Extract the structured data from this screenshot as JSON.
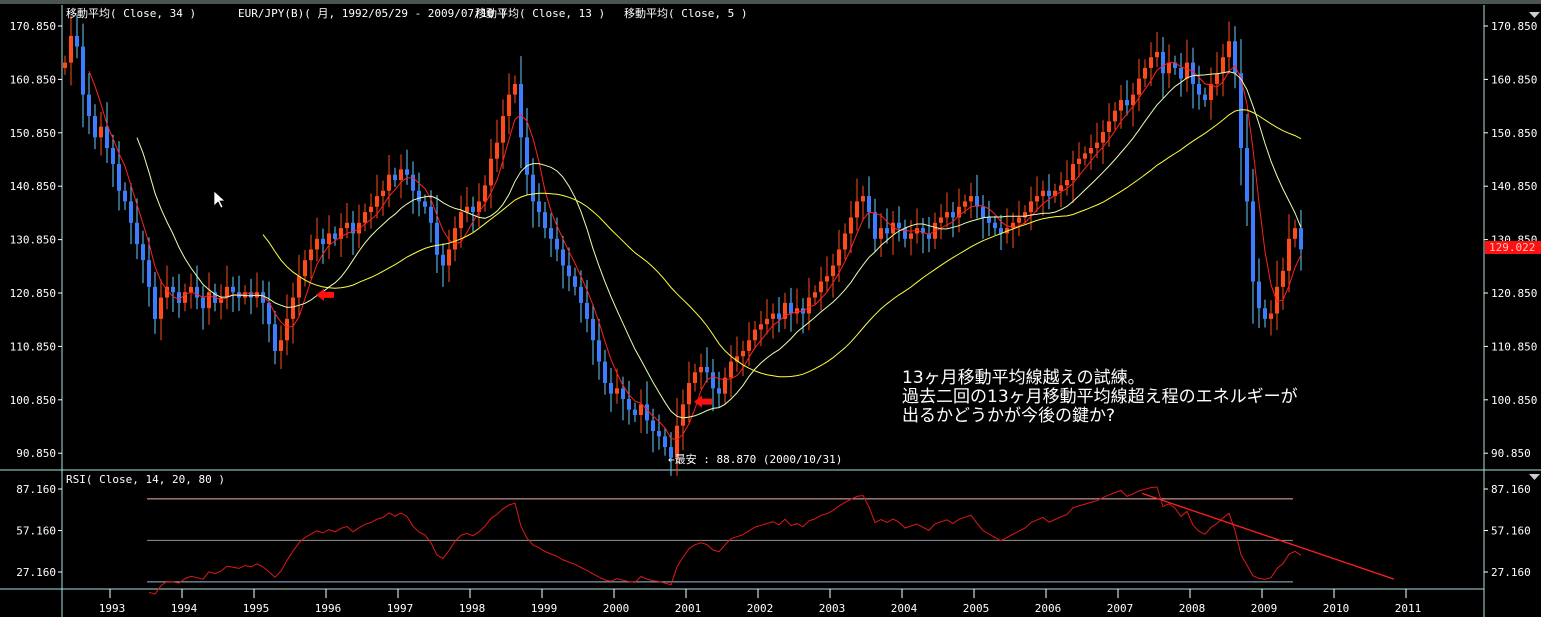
{
  "header": {
    "ma34_label": "移動平均( Close, 34 )",
    "symbol_label": "EUR/JPY(B)( 月, 1992/05/29 - 2009/07/10 )",
    "ma13_label": "移動平均( Close, 13 )",
    "ma5_label": "移動平均( Close, 5 )"
  },
  "rsi_pane": {
    "label": "RSI( Close, 14, 20, 80 )"
  },
  "current_price_label": "129.022",
  "low_annotation": "←最安 : 88.870 (2000/10/31)",
  "comment_lines": [
    "13ヶ月移動平均線越えの試練。",
    "過去二回の13ヶ月移動平均線超え程のエネルギーが",
    "出るかどうかが今後の鍵か?"
  ],
  "colors": {
    "up": "#ff4a1c",
    "down": "#3c7cff",
    "wick_down": "#66ccff",
    "ma5": "#ff2020",
    "ma13": "#e8ffb0",
    "ma34": "#ffff40",
    "rsi": "#e01818",
    "frame": "#a8e0e0",
    "price_badge": "#ff1010"
  },
  "chart_data": [
    {
      "type": "candlestick",
      "title": "EUR/JPY(B)( 月, 1992/05/29 - 2009/07/10 )",
      "start_month": "1992-05",
      "end_month": "2009-07",
      "interval": "monthly",
      "close": [
        164,
        169,
        167,
        158,
        154,
        150,
        152,
        148,
        145,
        140,
        138,
        134,
        130,
        127,
        122,
        116,
        120,
        122,
        121,
        119,
        121,
        122,
        120,
        118,
        121,
        119,
        120,
        122,
        121,
        120,
        121,
        120,
        121,
        119,
        115,
        110,
        112,
        116,
        120,
        124,
        127,
        129,
        131,
        130,
        132,
        131,
        133,
        134,
        132,
        134,
        136,
        137,
        139,
        140,
        143,
        142,
        144,
        143,
        140,
        138,
        137,
        134,
        128,
        126,
        129,
        133,
        136,
        137,
        136,
        138,
        141,
        146,
        149,
        154,
        158,
        160,
        150,
        143,
        138,
        136,
        133,
        131,
        129,
        126,
        124,
        122,
        119,
        116,
        112,
        108,
        104,
        102,
        103,
        101,
        99,
        98,
        100,
        97,
        95,
        94,
        92,
        90,
        96,
        100,
        104,
        106,
        107,
        106,
        103,
        102,
        105,
        108,
        109,
        110,
        112,
        114,
        115,
        116,
        117,
        116,
        119,
        117,
        118,
        117,
        120,
        121,
        123,
        124,
        126,
        129,
        132,
        135,
        138,
        139,
        136,
        131,
        133,
        132,
        134,
        133,
        131,
        132,
        133,
        132,
        131,
        134,
        135,
        136,
        135,
        137,
        138,
        139,
        137,
        135,
        134,
        133,
        132,
        133,
        134,
        135,
        136,
        138,
        139,
        140,
        139,
        140,
        141,
        142,
        145,
        146,
        147,
        148,
        149,
        151,
        153,
        155,
        157,
        156,
        158,
        161,
        163,
        165,
        166,
        162,
        164,
        163,
        161,
        164,
        160,
        158,
        157,
        160,
        162,
        165,
        168,
        162,
        148,
        138,
        123,
        118,
        116,
        117,
        122,
        125,
        131,
        133,
        129.022
      ],
      "moving_averages": [
        5,
        13,
        34
      ],
      "y_ticks": [
        "170.850",
        "160.850",
        "150.850",
        "140.850",
        "130.850",
        "120.850",
        "110.850",
        "100.850",
        "90.850"
      ],
      "ylim": [
        88.5,
        171.5
      ],
      "x_ticks": [
        "1993",
        "1994",
        "1995",
        "1996",
        "1997",
        "1998",
        "1999",
        "2000",
        "2001",
        "2002",
        "2003",
        "2004",
        "2005",
        "2006",
        "2007",
        "2008",
        "2009",
        "2010",
        "2011"
      ],
      "markers": [
        {
          "type": "arrow",
          "date": "1995-10",
          "value": 120.5
        },
        {
          "type": "arrow",
          "date": "2001-01",
          "value": 100.5
        }
      ],
      "low": {
        "value": 88.87,
        "date": "2000-10-31"
      }
    },
    {
      "type": "line",
      "title": "RSI( Close, 14, 20, 80 )",
      "period": 14,
      "levels": [
        20,
        50,
        80
      ],
      "y_ticks": [
        "87.160",
        "57.160",
        "27.160"
      ],
      "trendline": {
        "from": {
          "date": "2007-05",
          "value": 84
        },
        "to": {
          "date": "2010-11",
          "value": 22
        }
      }
    }
  ]
}
